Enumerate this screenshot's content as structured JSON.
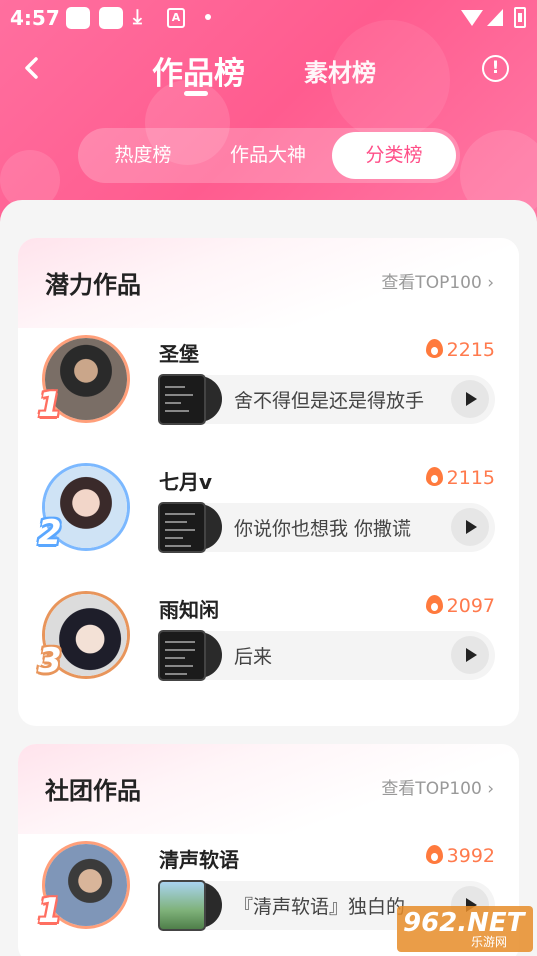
{
  "status_bar": {
    "time": "4:57",
    "download_icon": "download-icon",
    "a_badge": "A"
  },
  "nav": {
    "back_icon": "back-chevron-icon",
    "tabs": [
      "作品榜",
      "素材榜"
    ],
    "active_tab": "作品榜",
    "info_icon": "!"
  },
  "segment": {
    "items": [
      "热度榜",
      "作品大神",
      "分类榜"
    ],
    "active": "分类榜"
  },
  "sections": [
    {
      "title": "潜力作品",
      "more": "查看TOP100",
      "entries": [
        {
          "rank": "1",
          "name": "圣堡",
          "score": "2215",
          "track": "舍不得但是还是得放手"
        },
        {
          "rank": "2",
          "name": "七月v",
          "score": "2115",
          "track": "你说你也想我 你撒谎"
        },
        {
          "rank": "3",
          "name": "雨知闲",
          "score": "2097",
          "track": "后来"
        }
      ]
    },
    {
      "title": "社团作品",
      "more": "查看TOP100",
      "entries": [
        {
          "rank": "1",
          "name": "清声软语",
          "score": "3992",
          "track": "『清声软语』独白的"
        }
      ]
    }
  ],
  "watermark": {
    "text": "962.NET",
    "sub": "乐游网"
  },
  "colors": {
    "accent": "#ff5c8f",
    "score": "#ff7a4d",
    "active_segment_text": "#ff4f88"
  }
}
